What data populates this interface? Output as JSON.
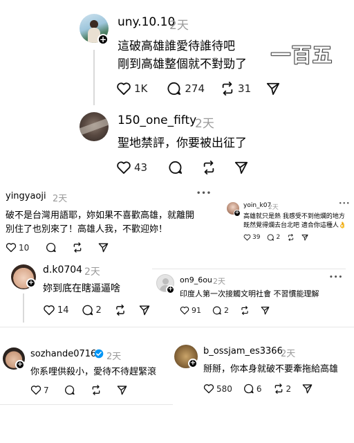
{
  "watermark": "一百五",
  "posts": [
    {
      "username": "uny.10.10",
      "time": "2天",
      "lines": [
        "這破高雄誰愛待誰待吧",
        "剛到高雄整個就不對勁了"
      ],
      "likes": "1K",
      "comments": "274",
      "reposts": "31"
    },
    {
      "username": "150_one_fifty",
      "time": "2天",
      "lines": [
        "聖地禁評，你要被出征了"
      ],
      "likes": "43"
    },
    {
      "username": "yingyaoji",
      "time": "2天",
      "lines": [
        "破不是台灣用語耶，妳如果不喜歡高雄，就離開",
        "別住了也別來了！高雄人我，不歡迎妳！"
      ],
      "likes": "10",
      "more": "•••"
    },
    {
      "username": "yoin_k07",
      "time": "2天",
      "lines": [
        "高雄就只是熱 我感受不到他爛的地方",
        "既然覺得爛去台北吧 適合你這種人👌"
      ],
      "likes": "39",
      "comments": "2",
      "more": "•••"
    },
    {
      "username": "d.k0704",
      "time": "2天",
      "lines": [
        "妳到底在瞎逼逼啥"
      ],
      "likes": "14",
      "comments": "2"
    },
    {
      "username": "on9_6ou",
      "time": "2天",
      "lines": [
        "印度人第一次接觸文明社會 不習慣能理解"
      ],
      "likes": "91",
      "comments": "2",
      "more": "•••"
    },
    {
      "username": "sozhande0716",
      "time": "2天",
      "lines": [
        "你系哩供殺小，愛待不待趕緊滾"
      ],
      "likes": "7"
    },
    {
      "username": "b_ossjam_es3366",
      "time": "2天",
      "lines": [
        "掰掰，你本身就破不要牽拖給高雄"
      ],
      "likes": "580",
      "comments": "6",
      "reposts": "2"
    }
  ]
}
